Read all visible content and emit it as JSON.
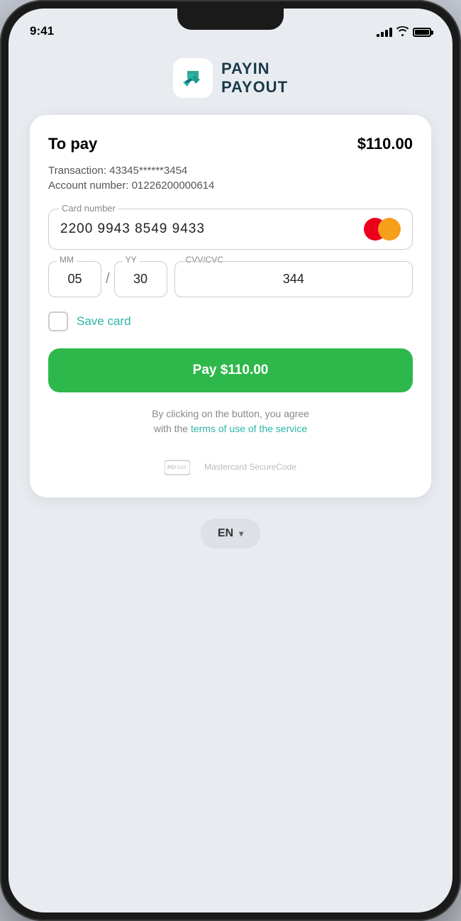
{
  "status_bar": {
    "time": "9:41"
  },
  "logo": {
    "name_line1": "PAYIN",
    "name_line2": "PAYOUT"
  },
  "payment": {
    "to_pay_label": "To pay",
    "amount": "$110.00",
    "transaction_label": "Transaction:",
    "transaction_id": "43345******3454",
    "account_label": "Account number:",
    "account_number": "01226200000614",
    "card_number_label": "Card number",
    "card_number": "2200 9943 8549 9433",
    "mm_label": "MM",
    "mm_value": "05",
    "yy_label": "YY",
    "yy_value": "30",
    "cvv_label": "CVV/CVC",
    "cvv_value": "344",
    "save_card_label": "Save card",
    "pay_button_label": "Pay $110.00",
    "terms_line1": "By clicking on the button, you agree",
    "terms_line2": "with the",
    "terms_link_text": "terms of use of the service",
    "pci_badge_label": "PCI DSS",
    "mc_securecode_label": "Mastercard SecureCode"
  },
  "language_selector": {
    "current": "EN",
    "dropdown_icon": "▾"
  }
}
